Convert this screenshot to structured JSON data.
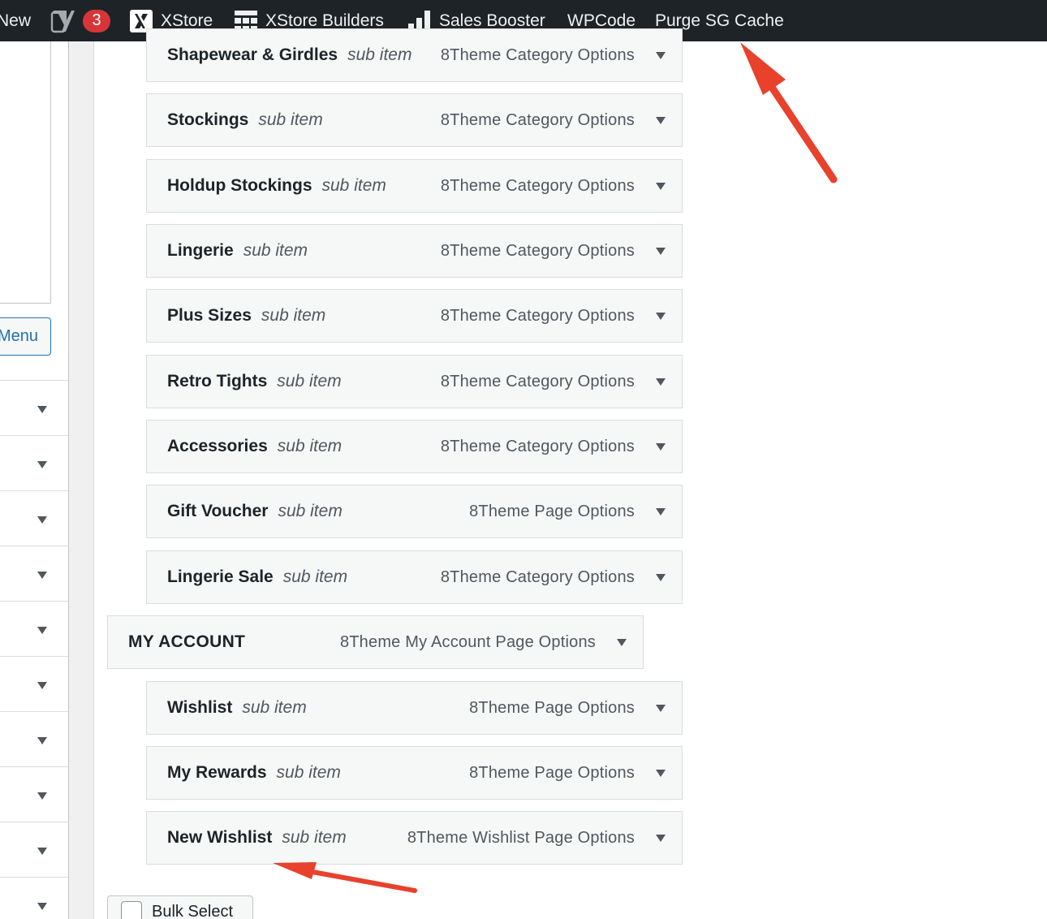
{
  "adminbar": {
    "new_label": "New",
    "yoast_count": "3",
    "xstore_label": "XStore",
    "builders_label": "XStore Builders",
    "booster_label": "Sales Booster",
    "wpcode_label": "WPCode",
    "purge_label": "Purge SG Cache"
  },
  "sidebar": {
    "menu_button_label": "Menu"
  },
  "menu_items": [
    {
      "title": "Shapewear & Girdles",
      "tag": "sub item",
      "type": "8Theme Category Options"
    },
    {
      "title": "Stockings",
      "tag": "sub item",
      "type": "8Theme Category Options"
    },
    {
      "title": "Holdup Stockings",
      "tag": "sub item",
      "type": "8Theme Category Options"
    },
    {
      "title": "Lingerie",
      "tag": "sub item",
      "type": "8Theme Category Options"
    },
    {
      "title": "Plus Sizes",
      "tag": "sub item",
      "type": "8Theme Category Options"
    },
    {
      "title": "Retro Tights",
      "tag": "sub item",
      "type": "8Theme Category Options"
    },
    {
      "title": "Accessories",
      "tag": "sub item",
      "type": "8Theme Category Options"
    },
    {
      "title": "Gift Voucher",
      "tag": "sub item",
      "type": "8Theme Page Options"
    },
    {
      "title": "Lingerie Sale",
      "tag": "sub item",
      "type": "8Theme Category Options"
    }
  ],
  "account_item": {
    "title": "MY ACCOUNT",
    "type": "8Theme My Account Page Options"
  },
  "account_children": [
    {
      "title": "Wishlist",
      "tag": "sub item",
      "type": "8Theme Page Options"
    },
    {
      "title": "My Rewards",
      "tag": "sub item",
      "type": "8Theme Page Options"
    },
    {
      "title": "New Wishlist",
      "tag": "sub item",
      "type": "8Theme Wishlist Page Options"
    }
  ],
  "bulk_select_label": "Bulk Select",
  "colors": {
    "adminbar": "#1d2327",
    "annotation": "#e8412c",
    "accent": "#2271b1"
  }
}
